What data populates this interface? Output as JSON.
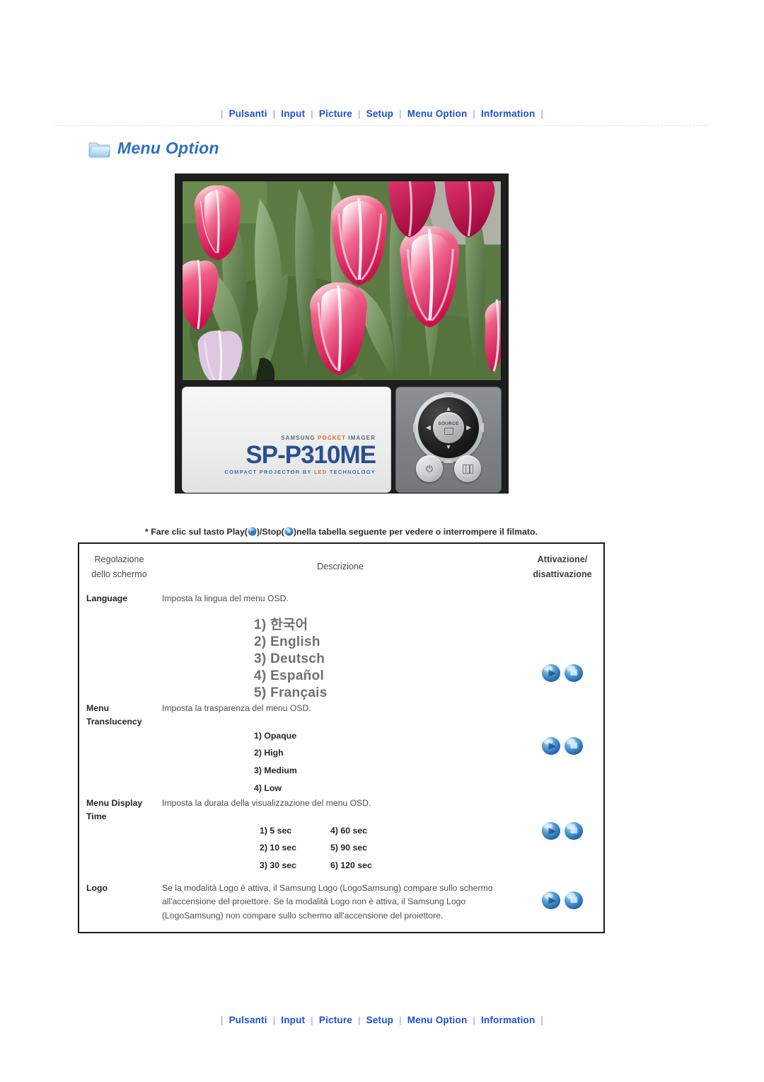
{
  "nav": {
    "items": [
      {
        "label": "Pulsanti"
      },
      {
        "label": "Input"
      },
      {
        "label": "Picture"
      },
      {
        "label": "Setup"
      },
      {
        "label": "Menu Option"
      },
      {
        "label": "Information"
      }
    ],
    "separator": "|"
  },
  "header": {
    "title": "Menu Option",
    "icon": "folder-icon"
  },
  "figure": {
    "screen_image": "tulips-photo",
    "device": {
      "brand_line": "SAMSUNG POCKET IMAGER",
      "brand_prefix": "SAMSUNG ",
      "brand_accent": "POCKET",
      "brand_suffix": " IMAGER",
      "model": "SP-P310ME",
      "tagline_prefix": "COMPACT PROJECTOR BY ",
      "tagline_accent": "LED",
      "tagline_suffix": " TECHNOLOGY",
      "source_label": "SOURCE",
      "arrows": {
        "up": "▲",
        "down": "▼",
        "left": "◀",
        "right": "▶"
      },
      "power_glyph": "⏻"
    }
  },
  "caption": {
    "part1": "* Fare clic sul tasto Play(",
    "part2": ")/Stop(",
    "part3": ")nella tabella seguente per vedere o interrompere il filmato."
  },
  "table": {
    "headers": {
      "col1_line1": "Regolazione",
      "col1_line2": "dello schermo",
      "col2": "Descrizione",
      "col3_line1": "Attivazione/",
      "col3_line2": "disattivazione"
    },
    "rows": [
      {
        "label": "Language",
        "label_line2": "",
        "description": "Imposta la lingua del menu OSD.",
        "options_style": "lang",
        "options": [
          "1) 한국어",
          "2) English",
          "3) Deutsch",
          "4) Español",
          "5) Français"
        ],
        "play_label": "Play",
        "stop_label": "Stop"
      },
      {
        "label": "Menu",
        "label_line2": "Translucency",
        "description": "Imposta la trasparenza del menu OSD.",
        "options_style": "bold",
        "options": [
          "1) Opaque",
          "2) High",
          "3) Medium",
          "4) Low"
        ],
        "play_label": "Play",
        "stop_label": "Stop"
      },
      {
        "label": "Menu Display",
        "label_line2": "Time",
        "description": "Imposta la durata della visualizzazione del menu OSD.",
        "options_style": "grid",
        "options_left": [
          "1) 5 sec",
          "2) 10 sec",
          "3) 30 sec"
        ],
        "options_right": [
          "4) 60 sec",
          "5) 90 sec",
          "6) 120 sec"
        ],
        "play_label": "Play",
        "stop_label": "Stop"
      },
      {
        "label": "Logo",
        "label_line2": "",
        "description": "Se la modalità Logo è attiva, il Samsung Logo (LogoSamsung) compare sullo schermo all'accensione del proiettore. Se la modalità Logo non è attiva, il Samsung Logo (LogoSamsung) non compare sullo schermo all'accensione del proiettore.",
        "options_style": "none",
        "options": [],
        "play_label": "Play",
        "stop_label": "Stop"
      }
    ]
  },
  "colors": {
    "nav_link": "#1b4fd8",
    "title": "#2a6fc4",
    "accent_orange": "#e8682c",
    "model_blue": "#2a4f8f",
    "ball_blue": "#3f92d2",
    "table_border": "#1c1c1c"
  }
}
